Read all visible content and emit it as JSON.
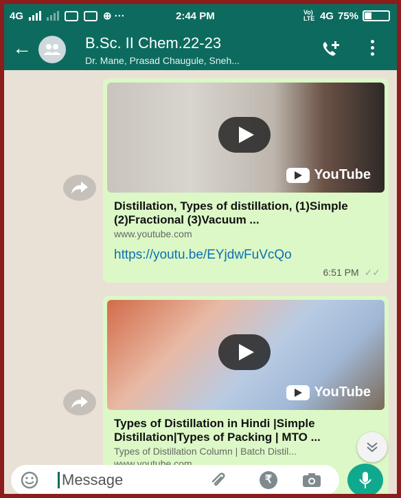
{
  "status_bar": {
    "network_left": "4G",
    "time": "2:44 PM",
    "network_right": "4G",
    "lte_label": "Vo) LTE",
    "battery": "75%"
  },
  "chat_header": {
    "title": "B.Sc. II Chem.22-23",
    "subtitle": "Dr. Mane, Prasad Chaugule, Sneh..."
  },
  "messages": [
    {
      "preview_source": "YouTube",
      "preview_title": "Distillation, Types of distillation, (1)Simple (2)Fractional (3)Vacuum ...",
      "preview_domain": "www.youtube.com",
      "link": "https://youtu.be/EYjdwFuVcQo",
      "time": "6:51 PM"
    },
    {
      "preview_source": "YouTube",
      "preview_title": "Types of Distillation in Hindi |Simple Distillation|Types of Packing | MTO ...",
      "preview_subtitle": "Types of Distillation Column | Batch Distil...",
      "preview_domain": "www.youtube.com"
    }
  ],
  "input": {
    "placeholder": "Message",
    "currency_symbol": "₹"
  },
  "colors": {
    "header": "#0c6b5e",
    "bubble": "#dcf8c6",
    "wallpaper": "#e9e1d6",
    "link": "#0b6fb3",
    "mic_button": "#11a98d"
  }
}
